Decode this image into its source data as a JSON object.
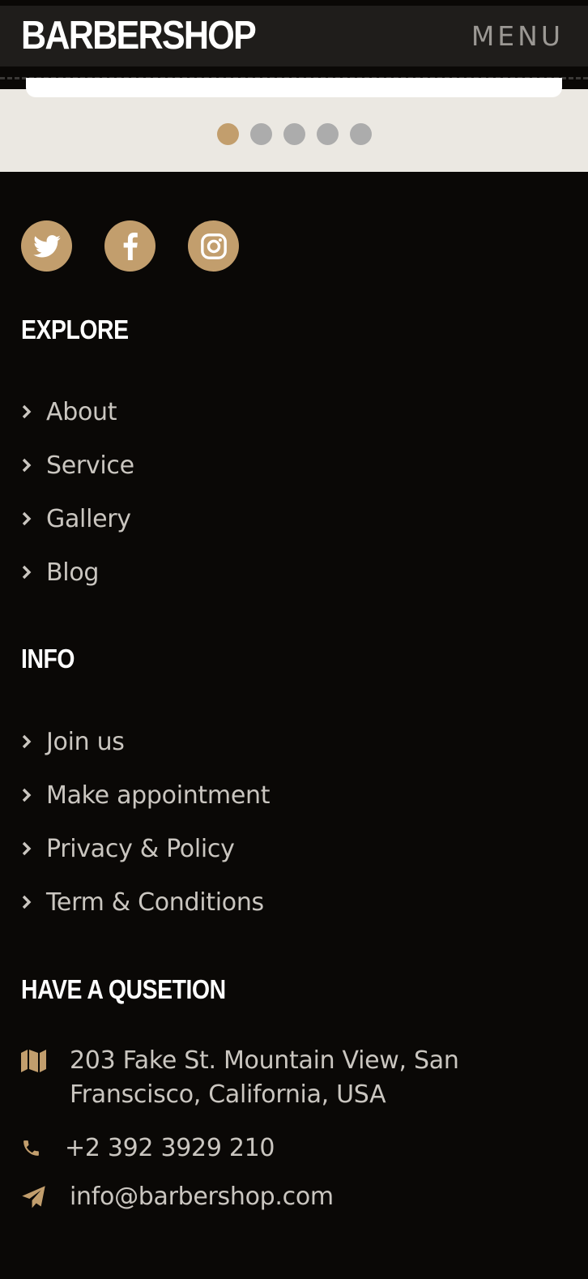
{
  "header": {
    "brand": "BARBERSHOP",
    "menu_label": "MENU"
  },
  "carousel": {
    "dot_count": 5,
    "active_index": 0
  },
  "colors": {
    "accent": "#c29e6d",
    "footer_bg": "#0a0806",
    "navbar_bg": "#1f1d1b",
    "carousel_bg": "#ebe8e2"
  },
  "socials": [
    {
      "name": "twitter",
      "icon": "twitter-icon"
    },
    {
      "name": "facebook",
      "icon": "facebook-icon"
    },
    {
      "name": "instagram",
      "icon": "instagram-icon"
    }
  ],
  "explore": {
    "heading": "EXPLORE",
    "links": [
      "About",
      "Service",
      "Gallery",
      "Blog"
    ]
  },
  "info": {
    "heading": "INFO",
    "links": [
      "Join us",
      "Make appointment",
      "Privacy & Policy",
      "Term & Conditions"
    ]
  },
  "question": {
    "heading": "HAVE A QUSETION",
    "address_line1": "203 Fake St. Mountain View, San",
    "address_line2": "Franscisco, California, USA",
    "phone": "+2 392 3929 210",
    "email": "info@barbershop.com"
  }
}
